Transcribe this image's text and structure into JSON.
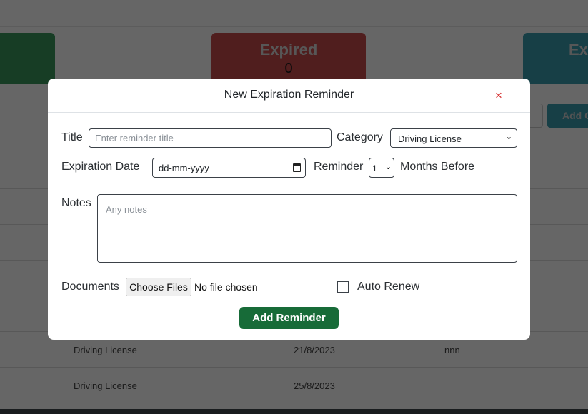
{
  "background": {
    "stat_cards": [
      {
        "label": "",
        "value": ""
      },
      {
        "label": "Expired",
        "value": "0"
      },
      {
        "label": "Ex",
        "value": ""
      }
    ],
    "add_button_label": "Add C",
    "table_rows": [
      {
        "category": "",
        "date": "",
        "notes": ""
      },
      {
        "category": "",
        "date": "",
        "notes": ""
      },
      {
        "category": "",
        "date": "",
        "notes": ""
      },
      {
        "category": "",
        "date": "",
        "notes": ""
      },
      {
        "category": "Driving License",
        "date": "21/8/2023",
        "notes": "nnn"
      },
      {
        "category": "Driving License",
        "date": "25/8/2023",
        "notes": ""
      }
    ]
  },
  "modal": {
    "title": "New Expiration Reminder",
    "close_icon": "×",
    "title_label": "Title",
    "title_placeholder": "Enter reminder title",
    "category_label": "Category",
    "category_value": "Driving License",
    "expiration_label": "Expiration Date",
    "expiration_placeholder": "dd-mm-yyyy",
    "reminder_label": "Reminder",
    "reminder_value": "1",
    "months_before_label": "Months Before",
    "notes_label": "Notes",
    "notes_placeholder": "Any notes",
    "documents_label": "Documents",
    "choose_files_label": "Choose Files",
    "no_file_text": "No file chosen",
    "auto_renew_label": "Auto Renew",
    "auto_renew_checked": false,
    "submit_label": "Add Reminder"
  },
  "colors": {
    "accent_green": "#176b38",
    "close_red": "#d42a2a",
    "card_red": "#c94b4b",
    "card_green": "#3a9a5c",
    "card_teal": "#3a9eb0"
  }
}
